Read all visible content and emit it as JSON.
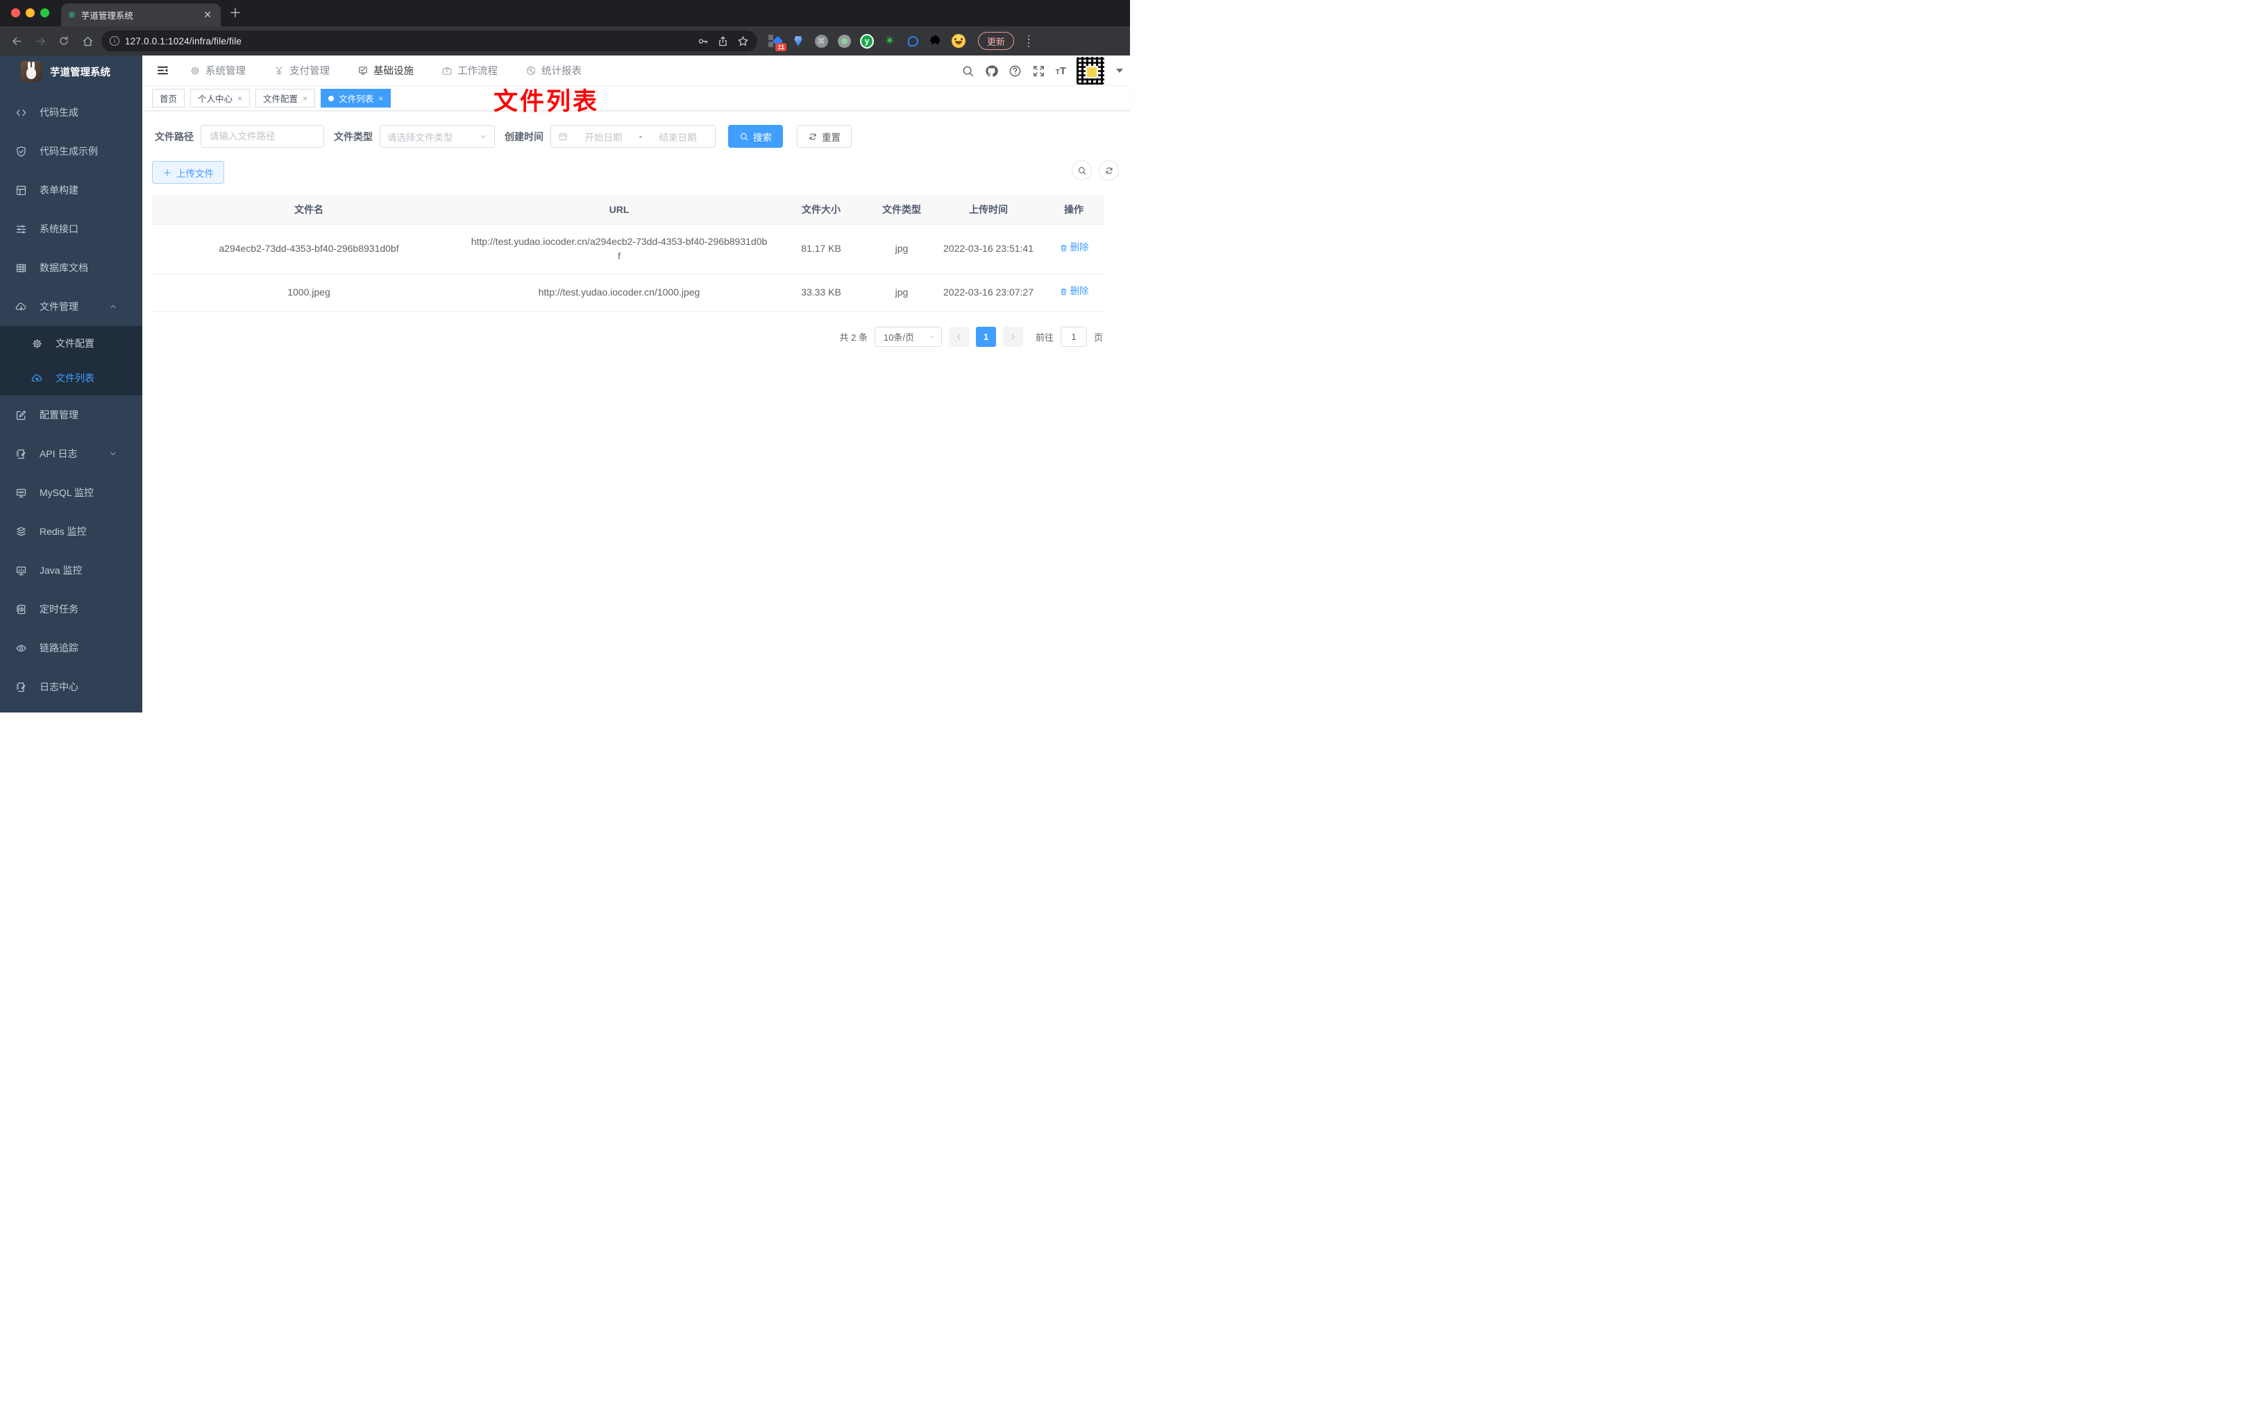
{
  "browser": {
    "tab_title": "芋道管理系统",
    "url": "127.0.0.1:1024/infra/file/file",
    "update_label": "更新",
    "extension_badge": "11"
  },
  "sidebar": {
    "title": "芋道管理系统",
    "items": [
      {
        "label": "代码生成",
        "icon": "code-icon"
      },
      {
        "label": "代码生成示例",
        "icon": "shield-icon"
      },
      {
        "label": "表单构建",
        "icon": "form-icon"
      },
      {
        "label": "系统接口",
        "icon": "sliders-icon"
      },
      {
        "label": "数据库文档",
        "icon": "table-icon"
      },
      {
        "label": "文件管理",
        "icon": "cloud-download-icon",
        "state": "expanded"
      },
      {
        "label": "文件配置",
        "icon": "gear-icon",
        "submenu": true
      },
      {
        "label": "文件列表",
        "icon": "cloud-upload-icon",
        "submenu": true,
        "active": true
      },
      {
        "label": "配置管理",
        "icon": "edit-icon"
      },
      {
        "label": "API 日志",
        "icon": "log-icon",
        "state": "collapsed"
      },
      {
        "label": "MySQL 监控",
        "icon": "monitor-icon"
      },
      {
        "label": "Redis 监控",
        "icon": "layers-icon"
      },
      {
        "label": "Java 监控",
        "icon": "display-icon"
      },
      {
        "label": "定时任务",
        "icon": "timer-icon"
      },
      {
        "label": "链路追踪",
        "icon": "eye-icon"
      },
      {
        "label": "日志中心",
        "icon": "doc-edit-icon"
      }
    ]
  },
  "nav": {
    "items": [
      {
        "label": "系统管理"
      },
      {
        "label": "支付管理"
      },
      {
        "label": "基础设施",
        "active": true
      },
      {
        "label": "工作流程"
      },
      {
        "label": "统计报表"
      }
    ]
  },
  "tabs": [
    {
      "label": "首页"
    },
    {
      "label": "个人中心",
      "closable": true
    },
    {
      "label": "文件配置",
      "closable": true
    },
    {
      "label": "文件列表",
      "closable": true,
      "active": true
    }
  ],
  "annotation": {
    "text": "文件列表",
    "color": "#ff0000"
  },
  "filters": {
    "path_label": "文件路径",
    "path_placeholder": "请输入文件路径",
    "type_label": "文件类型",
    "type_placeholder": "请选择文件类型",
    "time_label": "创建时间",
    "start_placeholder": "开始日期",
    "separator": "-",
    "end_placeholder": "结束日期",
    "search_label": "搜索",
    "reset_label": "重置"
  },
  "toolbar": {
    "upload_label": "上传文件"
  },
  "table": {
    "headers": [
      "文件名",
      "URL",
      "文件大小",
      "文件类型",
      "上传时间",
      "操作"
    ],
    "rows": [
      {
        "name": "a294ecb2-73dd-4353-bf40-296b8931d0bf",
        "url": "http://test.yudao.iocoder.cn/a294ecb2-73dd-4353-bf40-296b8931d0bf",
        "size": "81.17 KB",
        "type": "jpg",
        "time": "2022-03-16 23:51:41",
        "action": "删除"
      },
      {
        "name": "1000.jpeg",
        "url": "http://test.yudao.iocoder.cn/1000.jpeg",
        "size": "33.33 KB",
        "type": "jpg",
        "time": "2022-03-16 23:07:27",
        "action": "删除"
      }
    ]
  },
  "pagination": {
    "total": "共 2 条",
    "per_page": "10条/页",
    "page": "1",
    "goto_label": "前往",
    "goto_value": "1",
    "page_suffix": "页"
  },
  "colors": {
    "primary": "#409eff",
    "sidebar_bg": "#304156",
    "submenu_bg": "#1f2d3d",
    "annotation_red": "#ff0000"
  }
}
